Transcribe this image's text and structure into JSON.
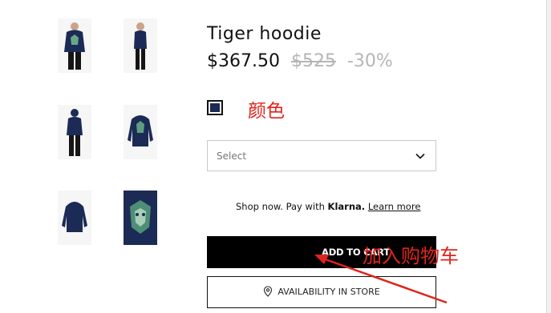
{
  "product": {
    "title": "Tiger hoodie",
    "price_now": "$367.50",
    "price_was": "$525",
    "discount": "-30%"
  },
  "color": {
    "swatch_hex": "#1a2a55",
    "annotation": "颜色"
  },
  "size_select": {
    "placeholder": "Select",
    "icon": "chevron-down-icon"
  },
  "klarna": {
    "prefix": "Shop now. Pay with ",
    "brand": "Klarna.",
    "link": "Learn more"
  },
  "actions": {
    "add_to_cart": "ADD TO CART",
    "availability": "AVAILABILITY IN STORE",
    "availability_icon": "location-pin-icon"
  },
  "annotations": {
    "add_to_cart_note": "加入购物车",
    "color": "#e0241b"
  },
  "thumbnails": [
    {
      "view": "front-model"
    },
    {
      "view": "side-model"
    },
    {
      "view": "back-model"
    },
    {
      "view": "front-flat"
    },
    {
      "view": "back-flat"
    },
    {
      "view": "detail-tiger"
    }
  ]
}
